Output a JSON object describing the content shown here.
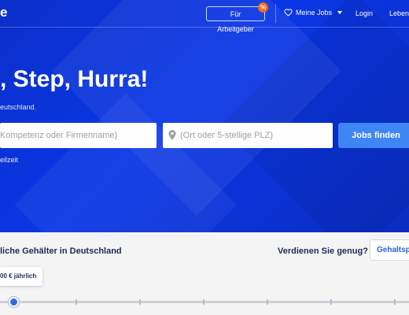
{
  "navbar": {
    "logo_fragment": "e",
    "employer_button": "Für Arbeitgeber",
    "promo_badge": "%",
    "my_jobs": "Meine Jobs",
    "login": "Login",
    "cv_fragment": "Lebens"
  },
  "hero": {
    "headline": ", Step, Hurra!",
    "subline": "eutschland.",
    "what_placeholder": "Kompetenz oder Firmenname)",
    "where_placeholder": "(Ort oder 5-stellige PLZ)",
    "search_button": "Jobs finden",
    "parttime_link": "eilzeit"
  },
  "salary": {
    "title": "liche Gehälter in Deutschland",
    "earn_enough": "Verdienen Sie genug?",
    "check_button": "Gehaltspl",
    "tooltip": "00 € jährlich",
    "slider_position": 0.03
  },
  "colors": {
    "hero_blue": "#0a37e6",
    "button_blue": "#3f86f5",
    "badge_orange": "#f26b1d",
    "dark_text": "#1e2a55"
  }
}
